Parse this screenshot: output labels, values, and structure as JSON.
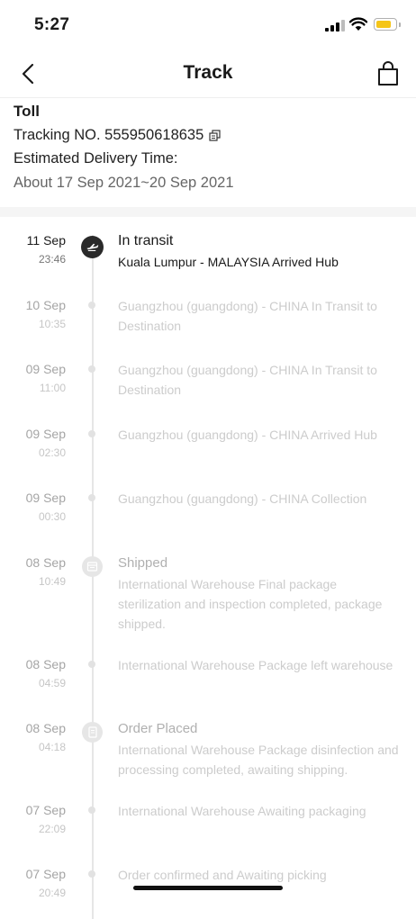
{
  "status_bar": {
    "time": "5:27"
  },
  "nav": {
    "title": "Track"
  },
  "shipment": {
    "carrier": "Toll",
    "tracking_label": "Tracking NO.",
    "tracking_number": "555950618635",
    "estimated_label": "Estimated Delivery Time:",
    "estimated_range": "About 17 Sep 2021~20 Sep 2021"
  },
  "timeline": [
    {
      "date": "11 Sep",
      "time": "23:46",
      "status": "In transit",
      "description": "Kuala Lumpur - MALAYSIA Arrived Hub",
      "icon": "airplane-icon",
      "active": true
    },
    {
      "date": "10 Sep",
      "time": "10:35",
      "status": "",
      "description": "Guangzhou (guangdong) - CHINA In Transit to Destination",
      "icon": "",
      "active": false
    },
    {
      "date": "09 Sep",
      "time": "11:00",
      "status": "",
      "description": "Guangzhou (guangdong) - CHINA In Transit to Destination",
      "icon": "",
      "active": false
    },
    {
      "date": "09 Sep",
      "time": "02:30",
      "status": "",
      "description": "Guangzhou (guangdong) - CHINA Arrived Hub",
      "icon": "",
      "active": false
    },
    {
      "date": "09 Sep",
      "time": "00:30",
      "status": "",
      "description": "Guangzhou (guangdong) - CHINA Collection",
      "icon": "",
      "active": false
    },
    {
      "date": "08 Sep",
      "time": "10:49",
      "status": "Shipped",
      "description": "International Warehouse Final package sterilization and inspection completed, package shipped.",
      "icon": "package-icon",
      "active": false
    },
    {
      "date": "08 Sep",
      "time": "04:59",
      "status": "",
      "description": "International Warehouse Package left warehouse",
      "icon": "",
      "active": false
    },
    {
      "date": "08 Sep",
      "time": "04:18",
      "status": "Order Placed",
      "description": "International Warehouse Package disinfection and processing completed, awaiting shipping.",
      "icon": "document-icon",
      "active": false
    },
    {
      "date": "07 Sep",
      "time": "22:09",
      "status": "",
      "description": "International Warehouse Awaiting packaging",
      "icon": "",
      "active": false
    },
    {
      "date": "07 Sep",
      "time": "20:49",
      "status": "",
      "description": "Order confirmed and Awaiting picking",
      "icon": "",
      "active": false
    }
  ]
}
